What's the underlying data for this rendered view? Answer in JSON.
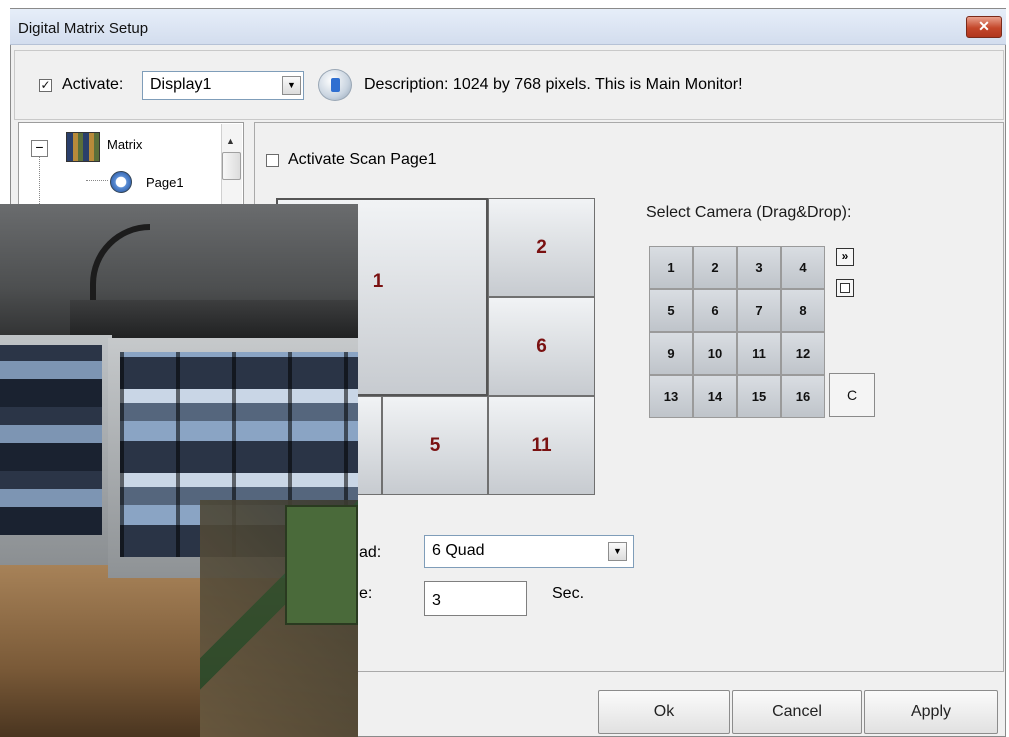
{
  "window": {
    "title": "Digital Matrix Setup",
    "close_glyph": "✕"
  },
  "top": {
    "activate_checked": "✓",
    "activate_label": "Activate:",
    "display_value": "Display1",
    "description": "Description: 1024 by 768 pixels. This is Main Monitor!"
  },
  "tree": {
    "expander": "−",
    "root_label": "Matrix",
    "child_label": "Page1",
    "scroll_up_glyph": "▲"
  },
  "scan": {
    "checked": "",
    "label": "Activate Scan Page1"
  },
  "layout_tiles": [
    "1",
    "2",
    "6",
    "",
    "5",
    "11"
  ],
  "cameras": {
    "label": "Select Camera (Drag&Drop):",
    "numbers": [
      "1",
      "2",
      "3",
      "4",
      "5",
      "6",
      "7",
      "8",
      "9",
      "10",
      "11",
      "12",
      "13",
      "14",
      "15",
      "16"
    ],
    "clear_label": "C",
    "next_glyph": "»"
  },
  "quad": {
    "label": "ad:",
    "value": "6 Quad",
    "dropdown_glyph": "▼"
  },
  "time": {
    "label": "e:",
    "value": "3",
    "unit": "Sec."
  },
  "buttons": {
    "ok": "Ok",
    "cancel": "Cancel",
    "apply": "Apply"
  },
  "icons": {
    "close": "close-icon",
    "info": "monitor-info-icon",
    "matrix": "matrix-grid-icon",
    "page": "clock-page-icon",
    "next": "double-chevron-right-icon",
    "single_view": "single-view-icon"
  },
  "colors": {
    "tile_number": "#7a1111",
    "close_button": "#c4472b",
    "input_border": "#7f9db9"
  }
}
